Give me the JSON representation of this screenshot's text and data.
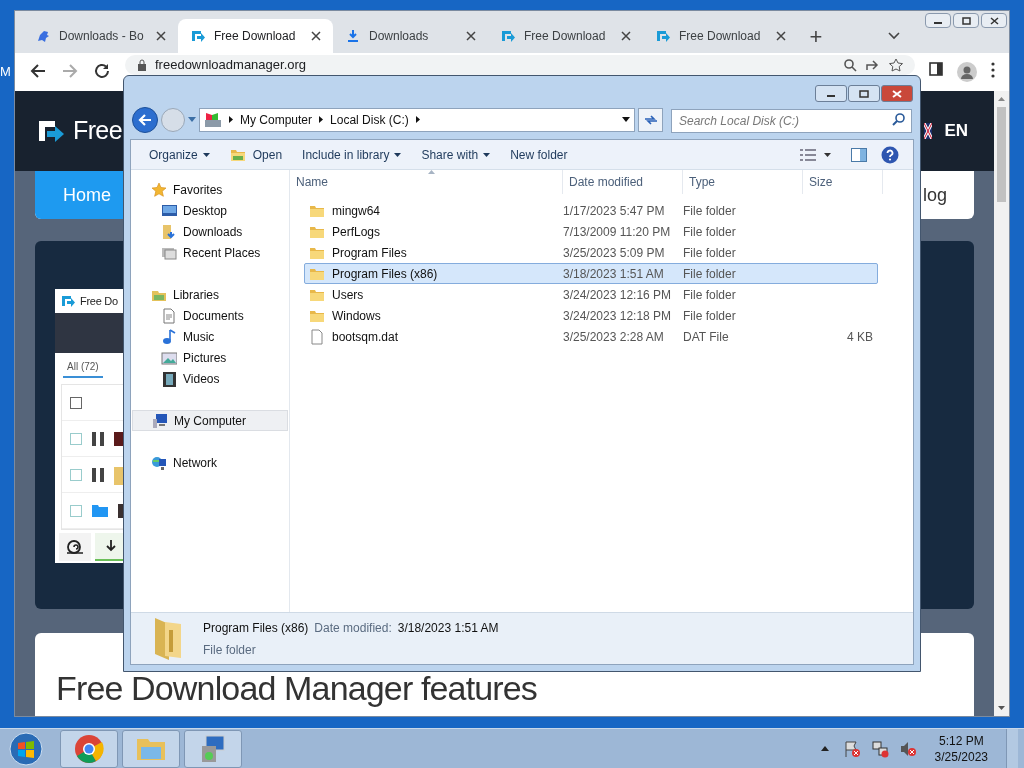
{
  "desktop": {
    "icon_label": "M"
  },
  "browser": {
    "tabs": [
      {
        "kind": "bot",
        "title": "Downloads - Bo",
        "selected": false
      },
      {
        "kind": "fdm",
        "title": "Free Download",
        "selected": true
      },
      {
        "kind": "download",
        "title": "Downloads",
        "selected": false
      },
      {
        "kind": "fdm",
        "title": "Free Download",
        "selected": false
      },
      {
        "kind": "fdm",
        "title": "Free Download",
        "selected": false
      }
    ],
    "new_tab": "+",
    "url": "freedownloadmanager.org",
    "page": {
      "logo": "Free",
      "language": "EN",
      "nav": [
        {
          "label": "Home",
          "selected": true
        },
        {
          "label": "log",
          "selected": false
        }
      ],
      "app_preview": {
        "title": "Free Do",
        "filter_tab": "All (72)",
        "rows": [
          {
            "kind": "header",
            "checked": false
          },
          {
            "kind": "paused",
            "checked": false
          },
          {
            "kind": "paused-folder",
            "checked": false
          },
          {
            "kind": "folder",
            "checked": false
          }
        ]
      },
      "heading": "Free Download Manager features"
    }
  },
  "explorer": {
    "breadcrumb": [
      "My Computer",
      "Local Disk (C:)"
    ],
    "search": {
      "placeholder": "Search Local Disk (C:)"
    },
    "toolbar": [
      {
        "kind": "menu",
        "label": "Organize"
      },
      {
        "kind": "open",
        "label": "Open"
      },
      {
        "kind": "menu",
        "label": "Include in library"
      },
      {
        "kind": "menu",
        "label": "Share with"
      },
      {
        "kind": "plain",
        "label": "New folder"
      }
    ],
    "nav": [
      {
        "label": "Favorites",
        "selected": false,
        "children": [
          {
            "label": "Desktop",
            "selected": false
          },
          {
            "label": "Downloads",
            "selected": false
          },
          {
            "label": "Recent Places",
            "selected": false
          }
        ]
      },
      {
        "label": "Libraries",
        "selected": false,
        "children": [
          {
            "label": "Documents",
            "selected": false
          },
          {
            "label": "Music",
            "selected": false
          },
          {
            "label": "Pictures",
            "selected": false
          },
          {
            "label": "Videos",
            "selected": false
          }
        ]
      },
      {
        "label": "My Computer",
        "selected": true
      },
      {
        "label": "Network",
        "selected": false
      }
    ],
    "columns": [
      "Name",
      "Date modified",
      "Type",
      "Size"
    ],
    "rows": [
      {
        "kind": "folder",
        "name": "mingw64",
        "date": "1/17/2023 5:47 PM",
        "type": "File folder",
        "selected": false
      },
      {
        "kind": "folder",
        "name": "PerfLogs",
        "date": "7/13/2009 11:20 PM",
        "type": "File folder",
        "selected": false
      },
      {
        "kind": "folder",
        "name": "Program Files",
        "date": "3/25/2023 5:09 PM",
        "type": "File folder",
        "selected": false
      },
      {
        "kind": "folder",
        "name": "Program Files (x86)",
        "date": "3/18/2023 1:51 AM",
        "type": "File folder",
        "selected": true
      },
      {
        "kind": "folder",
        "name": "Users",
        "date": "3/24/2023 12:16 PM",
        "type": "File folder",
        "selected": false
      },
      {
        "kind": "folder",
        "name": "Windows",
        "date": "3/24/2023 12:18 PM",
        "type": "File folder",
        "selected": false
      },
      {
        "kind": "file",
        "name": "bootsqm.dat",
        "date": "3/25/2023 2:28 AM",
        "type": "DAT File",
        "size": "4 KB",
        "selected": false
      }
    ],
    "details": {
      "name": "Program Files (x86)",
      "date_label": "Date modified:",
      "date": "3/18/2023 1:51 AM",
      "type": "File folder"
    }
  },
  "taskbar": {
    "time": "5:12 PM",
    "date": "3/25/2023"
  }
}
